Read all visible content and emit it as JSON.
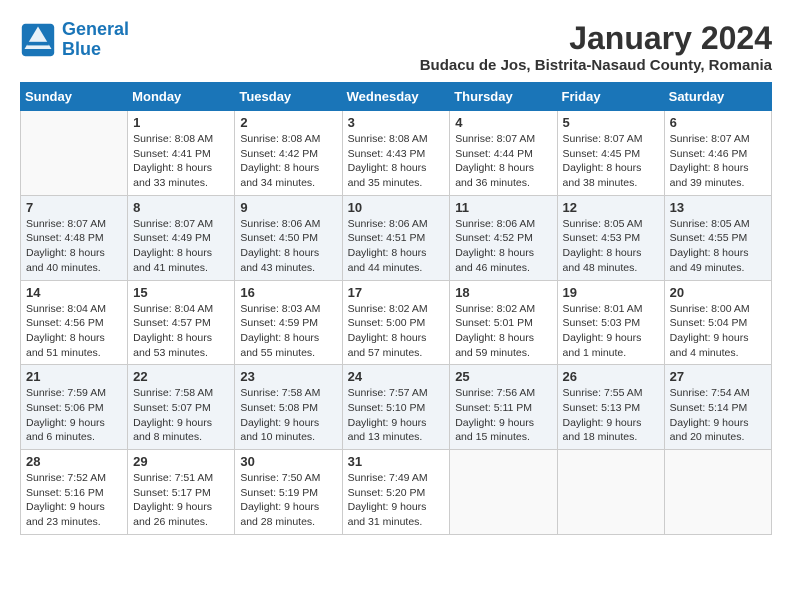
{
  "logo": {
    "line1": "General",
    "line2": "Blue"
  },
  "title": "January 2024",
  "subtitle": "Budacu de Jos, Bistrita-Nasaud County, Romania",
  "weekdays": [
    "Sunday",
    "Monday",
    "Tuesday",
    "Wednesday",
    "Thursday",
    "Friday",
    "Saturday"
  ],
  "weeks": [
    [
      {
        "day": "",
        "info": ""
      },
      {
        "day": "1",
        "info": "Sunrise: 8:08 AM\nSunset: 4:41 PM\nDaylight: 8 hours\nand 33 minutes."
      },
      {
        "day": "2",
        "info": "Sunrise: 8:08 AM\nSunset: 4:42 PM\nDaylight: 8 hours\nand 34 minutes."
      },
      {
        "day": "3",
        "info": "Sunrise: 8:08 AM\nSunset: 4:43 PM\nDaylight: 8 hours\nand 35 minutes."
      },
      {
        "day": "4",
        "info": "Sunrise: 8:07 AM\nSunset: 4:44 PM\nDaylight: 8 hours\nand 36 minutes."
      },
      {
        "day": "5",
        "info": "Sunrise: 8:07 AM\nSunset: 4:45 PM\nDaylight: 8 hours\nand 38 minutes."
      },
      {
        "day": "6",
        "info": "Sunrise: 8:07 AM\nSunset: 4:46 PM\nDaylight: 8 hours\nand 39 minutes."
      }
    ],
    [
      {
        "day": "7",
        "info": "Sunrise: 8:07 AM\nSunset: 4:48 PM\nDaylight: 8 hours\nand 40 minutes."
      },
      {
        "day": "8",
        "info": "Sunrise: 8:07 AM\nSunset: 4:49 PM\nDaylight: 8 hours\nand 41 minutes."
      },
      {
        "day": "9",
        "info": "Sunrise: 8:06 AM\nSunset: 4:50 PM\nDaylight: 8 hours\nand 43 minutes."
      },
      {
        "day": "10",
        "info": "Sunrise: 8:06 AM\nSunset: 4:51 PM\nDaylight: 8 hours\nand 44 minutes."
      },
      {
        "day": "11",
        "info": "Sunrise: 8:06 AM\nSunset: 4:52 PM\nDaylight: 8 hours\nand 46 minutes."
      },
      {
        "day": "12",
        "info": "Sunrise: 8:05 AM\nSunset: 4:53 PM\nDaylight: 8 hours\nand 48 minutes."
      },
      {
        "day": "13",
        "info": "Sunrise: 8:05 AM\nSunset: 4:55 PM\nDaylight: 8 hours\nand 49 minutes."
      }
    ],
    [
      {
        "day": "14",
        "info": "Sunrise: 8:04 AM\nSunset: 4:56 PM\nDaylight: 8 hours\nand 51 minutes."
      },
      {
        "day": "15",
        "info": "Sunrise: 8:04 AM\nSunset: 4:57 PM\nDaylight: 8 hours\nand 53 minutes."
      },
      {
        "day": "16",
        "info": "Sunrise: 8:03 AM\nSunset: 4:59 PM\nDaylight: 8 hours\nand 55 minutes."
      },
      {
        "day": "17",
        "info": "Sunrise: 8:02 AM\nSunset: 5:00 PM\nDaylight: 8 hours\nand 57 minutes."
      },
      {
        "day": "18",
        "info": "Sunrise: 8:02 AM\nSunset: 5:01 PM\nDaylight: 8 hours\nand 59 minutes."
      },
      {
        "day": "19",
        "info": "Sunrise: 8:01 AM\nSunset: 5:03 PM\nDaylight: 9 hours\nand 1 minute."
      },
      {
        "day": "20",
        "info": "Sunrise: 8:00 AM\nSunset: 5:04 PM\nDaylight: 9 hours\nand 4 minutes."
      }
    ],
    [
      {
        "day": "21",
        "info": "Sunrise: 7:59 AM\nSunset: 5:06 PM\nDaylight: 9 hours\nand 6 minutes."
      },
      {
        "day": "22",
        "info": "Sunrise: 7:58 AM\nSunset: 5:07 PM\nDaylight: 9 hours\nand 8 minutes."
      },
      {
        "day": "23",
        "info": "Sunrise: 7:58 AM\nSunset: 5:08 PM\nDaylight: 9 hours\nand 10 minutes."
      },
      {
        "day": "24",
        "info": "Sunrise: 7:57 AM\nSunset: 5:10 PM\nDaylight: 9 hours\nand 13 minutes."
      },
      {
        "day": "25",
        "info": "Sunrise: 7:56 AM\nSunset: 5:11 PM\nDaylight: 9 hours\nand 15 minutes."
      },
      {
        "day": "26",
        "info": "Sunrise: 7:55 AM\nSunset: 5:13 PM\nDaylight: 9 hours\nand 18 minutes."
      },
      {
        "day": "27",
        "info": "Sunrise: 7:54 AM\nSunset: 5:14 PM\nDaylight: 9 hours\nand 20 minutes."
      }
    ],
    [
      {
        "day": "28",
        "info": "Sunrise: 7:52 AM\nSunset: 5:16 PM\nDaylight: 9 hours\nand 23 minutes."
      },
      {
        "day": "29",
        "info": "Sunrise: 7:51 AM\nSunset: 5:17 PM\nDaylight: 9 hours\nand 26 minutes."
      },
      {
        "day": "30",
        "info": "Sunrise: 7:50 AM\nSunset: 5:19 PM\nDaylight: 9 hours\nand 28 minutes."
      },
      {
        "day": "31",
        "info": "Sunrise: 7:49 AM\nSunset: 5:20 PM\nDaylight: 9 hours\nand 31 minutes."
      },
      {
        "day": "",
        "info": ""
      },
      {
        "day": "",
        "info": ""
      },
      {
        "day": "",
        "info": ""
      }
    ]
  ]
}
